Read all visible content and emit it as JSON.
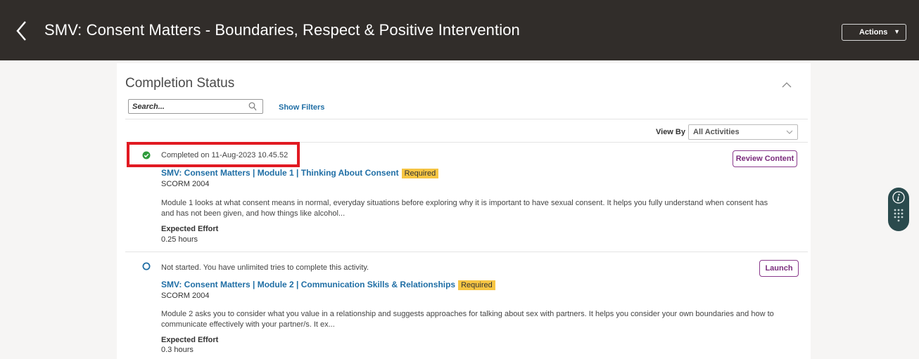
{
  "header": {
    "title": "SMV: Consent Matters - Boundaries, Respect & Positive Intervention",
    "actions_label": "Actions"
  },
  "completion": {
    "title": "Completion Status",
    "search_placeholder": "Search...",
    "show_filters": "Show Filters",
    "view_by_label": "View By",
    "view_by_value": "All Activities"
  },
  "activities": [
    {
      "status": "Completed on 11-Aug-2023 10.45.52",
      "title": "SMV: Consent Matters | Module 1 | Thinking About Consent",
      "badge": "Required",
      "type": "SCORM 2004",
      "description": "Module 1 looks at what consent means in normal, everyday situations before exploring why it is important to have sexual consent. It helps you fully understand when consent has and has not been given, and how things like alcohol...",
      "effort_label": "Expected Effort",
      "effort_value": "0.25 hours",
      "button": "Review Content"
    },
    {
      "status": "Not started. You have unlimited tries to complete this activity.",
      "title": "SMV: Consent Matters | Module 2 | Communication Skills & Relationships",
      "badge": "Required",
      "type": "SCORM 2004",
      "description": "Module 2 asks you to consider what you value in a relationship and suggests approaches for talking about sex with partners. It helps you consider your own boundaries and how to communicate effectively with your partner/s. It ex...",
      "effort_label": "Expected Effort",
      "effort_value": "0.3 hours",
      "button": "Launch"
    }
  ],
  "colors": {
    "header_bg": "#312d2a",
    "link": "#1f6ea5",
    "badge": "#f6c543",
    "button": "#7a2b7c",
    "highlight": "#e11a22",
    "completed": "#2e9b3b",
    "not_started": "#1f6ea5"
  }
}
